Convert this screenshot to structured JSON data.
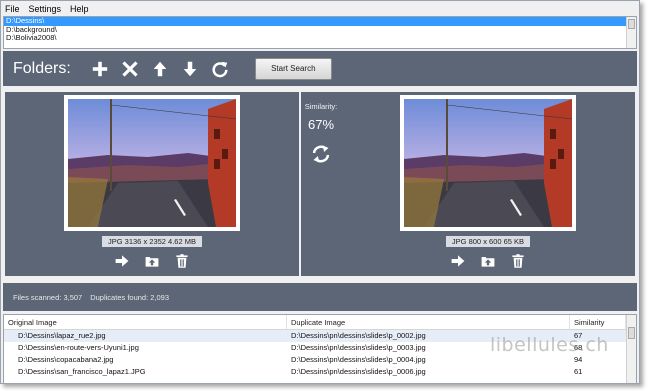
{
  "menu": {
    "items": [
      {
        "label": "File"
      },
      {
        "label": "Settings"
      },
      {
        "label": "Help"
      }
    ]
  },
  "folders": {
    "items": [
      {
        "path": "D:\\Dessins\\",
        "selected": true
      },
      {
        "path": "D:\\background\\",
        "selected": false
      },
      {
        "path": "D:\\Bolivia2008\\",
        "selected": false
      }
    ]
  },
  "toolbar": {
    "label": "Folders:",
    "add_icon": "plus-icon",
    "remove_icon": "x-icon",
    "up_icon": "arrow-up-icon",
    "down_icon": "arrow-down-icon",
    "reset_icon": "refresh-icon",
    "start_label": "Start Search"
  },
  "similarity": {
    "label": "Similarity:",
    "value": "67%"
  },
  "left_image": {
    "info": "JPG  3136 x 2352  4.62 MB"
  },
  "right_image": {
    "info": "JPG  800 x 600  65 KB"
  },
  "status": {
    "files_scanned": "Files scanned: 3,507",
    "duplicates_found": "Duplicates found: 2,093"
  },
  "results": {
    "headers": {
      "original": "Original Image",
      "duplicate": "Duplicate Image",
      "similarity": "Similarity"
    },
    "rows": [
      {
        "original": "D:\\Dessins\\lapaz_rue2.jpg",
        "duplicate": "D:\\Dessins\\pn\\dessins\\slides\\p_0002.jpg",
        "similarity": "67",
        "selected": true
      },
      {
        "original": "D:\\Dessins\\en-route-vers-Uyuni1.jpg",
        "duplicate": "D:\\Dessins\\pn\\dessins\\slides\\p_0003.jpg",
        "similarity": "68",
        "selected": false
      },
      {
        "original": "D:\\Dessins\\copacabana2.jpg",
        "duplicate": "D:\\Dessins\\pn\\dessins\\slides\\p_0004.jpg",
        "similarity": "94",
        "selected": false
      },
      {
        "original": "D:\\Dessins\\san_francisco_lapaz1.JPG",
        "duplicate": "D:\\Dessins\\pn\\dessins\\slides\\p_0006.jpg",
        "similarity": "61",
        "selected": false
      }
    ]
  },
  "watermark": "libellules.ch",
  "colors": {
    "panel": "#5c6677",
    "selection": "#3399ff",
    "window_bg": "#f0f0f0"
  }
}
